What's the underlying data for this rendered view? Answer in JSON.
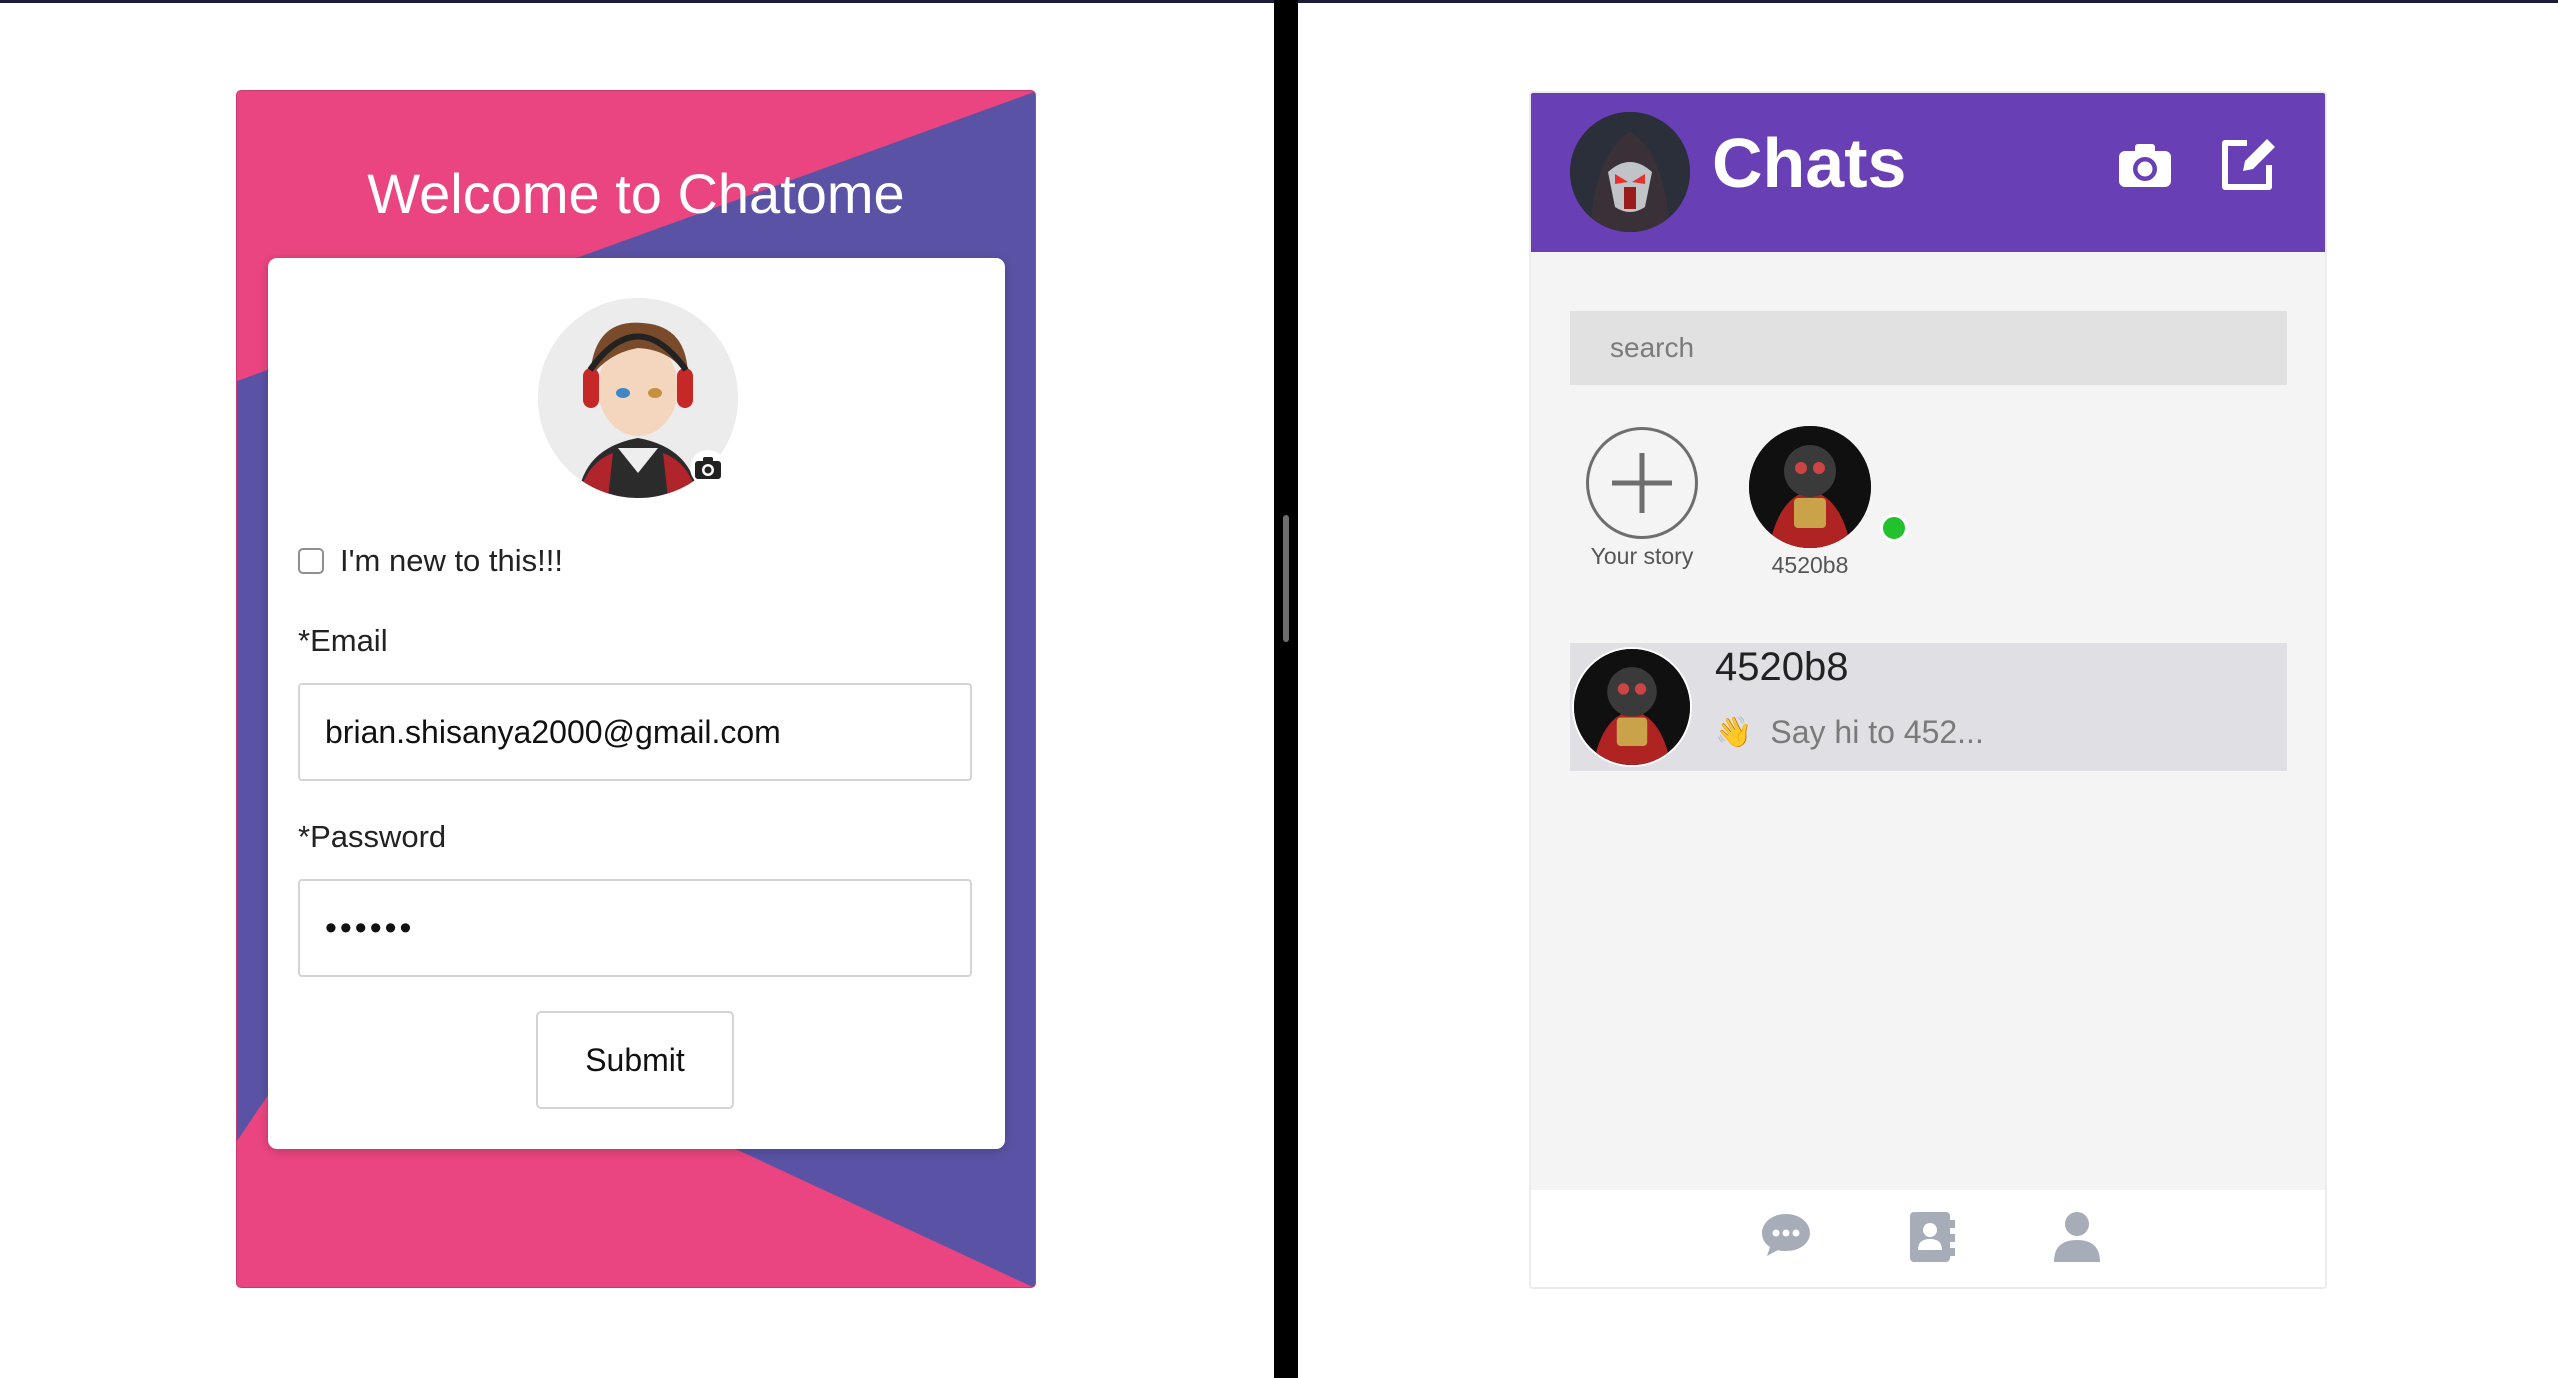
{
  "login": {
    "title": "Welcome to Chatome",
    "checkbox_label": "I'm new to this!!!",
    "email_label": "*Email",
    "email_value": "brian.shisanya2000@gmail.com",
    "password_label": "*Password",
    "password_value": "••••••",
    "submit_label": "Submit",
    "checkbox_checked": false,
    "colors": {
      "pink": "#ea4580",
      "purple": "#5a53a5"
    }
  },
  "chats": {
    "title": "Chats",
    "header_color": "#683fb5",
    "search_placeholder": "search",
    "stories": [
      {
        "label": "Your story",
        "icon": "plus-icon"
      },
      {
        "label": "4520b8",
        "online": true
      }
    ],
    "conversations": [
      {
        "name": "4520b8",
        "emoji": "👋",
        "preview": "Say hi to 452..."
      }
    ],
    "nav": [
      "chat-bubble-icon",
      "contacts-icon",
      "profile-icon"
    ],
    "online_color": "#22c22e"
  }
}
